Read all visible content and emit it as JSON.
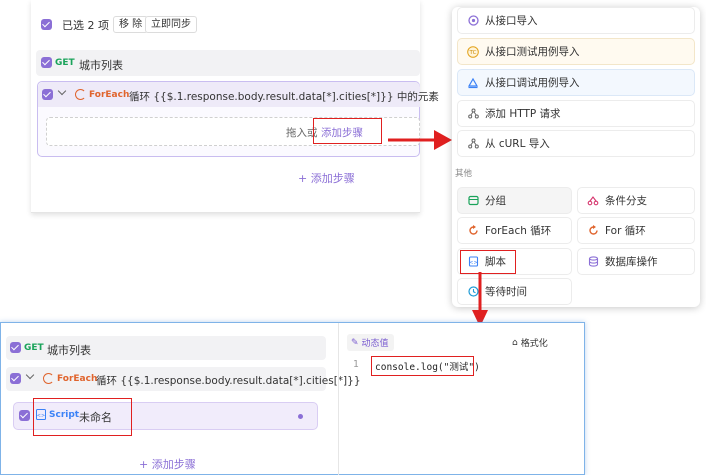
{
  "panel1": {
    "selection_text": "已选 2 项",
    "remove_btn": "移 除",
    "sync_btn": "立即同步",
    "get_tag": "GET",
    "step_city": "城市列表",
    "foreach_tag": "ForEach",
    "foreach_label": "循环 {{$.1.response.body.result.data[*].cities[*]}} 中的元素",
    "drop_hint_prefix": "拖入或",
    "drop_hint_link": "添加步骤",
    "add_step": "+ 添加步骤"
  },
  "menu": {
    "items_top": [
      {
        "icon": "import-api-icon",
        "label": "从接口导入"
      },
      {
        "icon": "tc-icon",
        "label": "从接口测试用例导入"
      },
      {
        "icon": "debug-case-icon",
        "label": "从接口调试用例导入"
      },
      {
        "icon": "http-icon",
        "label": "添加 HTTP 请求"
      },
      {
        "icon": "curl-icon",
        "label": "从 cURL 导入"
      }
    ],
    "section_other": "其他",
    "grid": [
      {
        "icon": "group-icon",
        "label": "分组"
      },
      {
        "icon": "branch-icon",
        "label": "条件分支"
      },
      {
        "icon": "foreach-icon",
        "label": "ForEach 循环"
      },
      {
        "icon": "for-icon",
        "label": "For 循环"
      },
      {
        "icon": "script-icon",
        "label": "脚本"
      },
      {
        "icon": "database-icon",
        "label": "数据库操作"
      },
      {
        "icon": "clock-icon",
        "label": "等待时间"
      }
    ]
  },
  "panel3": {
    "get_tag": "GET",
    "step_city": "城市列表",
    "foreach_tag": "ForEach",
    "foreach_label": "循环 {{$.1.response.body.result.data[*].cities[*]}}",
    "script_tag": "Script",
    "script_name": "未命名",
    "add_step": "+ 添加步骤",
    "dynamic_value": "动态值",
    "format_btn": "格式化",
    "line_no": "1",
    "code": "console.log(\"测试\")"
  },
  "colors": {
    "accent": "#8b6fd6",
    "get": "#1aa35a",
    "foreach": "#e0642d",
    "highlight": "#e02020"
  }
}
